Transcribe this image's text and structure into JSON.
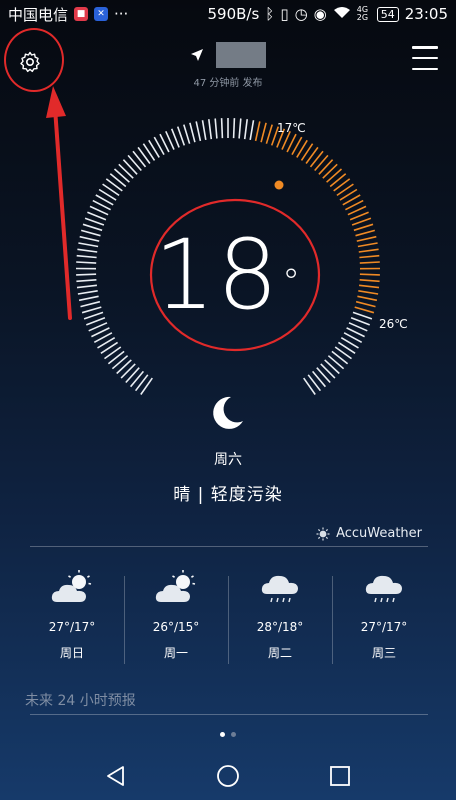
{
  "status_bar": {
    "carrier": "中国电信",
    "more": "···",
    "speed": "590B/s",
    "signal_label": "4G 2G",
    "battery": "54",
    "time": "23:05"
  },
  "header": {
    "publish_time": "47 分钟前 发布",
    "icons": [
      "gear-icon",
      "location-arrow-icon",
      "menu-icon"
    ]
  },
  "current": {
    "temperature": "18",
    "unit": "°",
    "temp_max": "17℃",
    "temp_min": "26℃",
    "weekday": "周六",
    "condition": "晴 | 轻度污染",
    "icon": "moon-icon"
  },
  "provider": {
    "name": "AccuWeather",
    "icon": "sun-logo-icon"
  },
  "forecast": [
    {
      "temp": "27°/17°",
      "day": "周日",
      "icon": "partly-cloudy-icon"
    },
    {
      "temp": "26°/15°",
      "day": "周一",
      "icon": "partly-cloudy-icon"
    },
    {
      "temp": "28°/18°",
      "day": "周二",
      "icon": "rain-icon"
    },
    {
      "temp": "27°/17°",
      "day": "周三",
      "icon": "rain-icon"
    }
  ],
  "hours24_label": "未来 24 小时预报",
  "pager": {
    "pages": 2,
    "active": 1
  },
  "colors": {
    "accent_orange": "#f08a24",
    "annotation_red": "#e12a2a"
  }
}
